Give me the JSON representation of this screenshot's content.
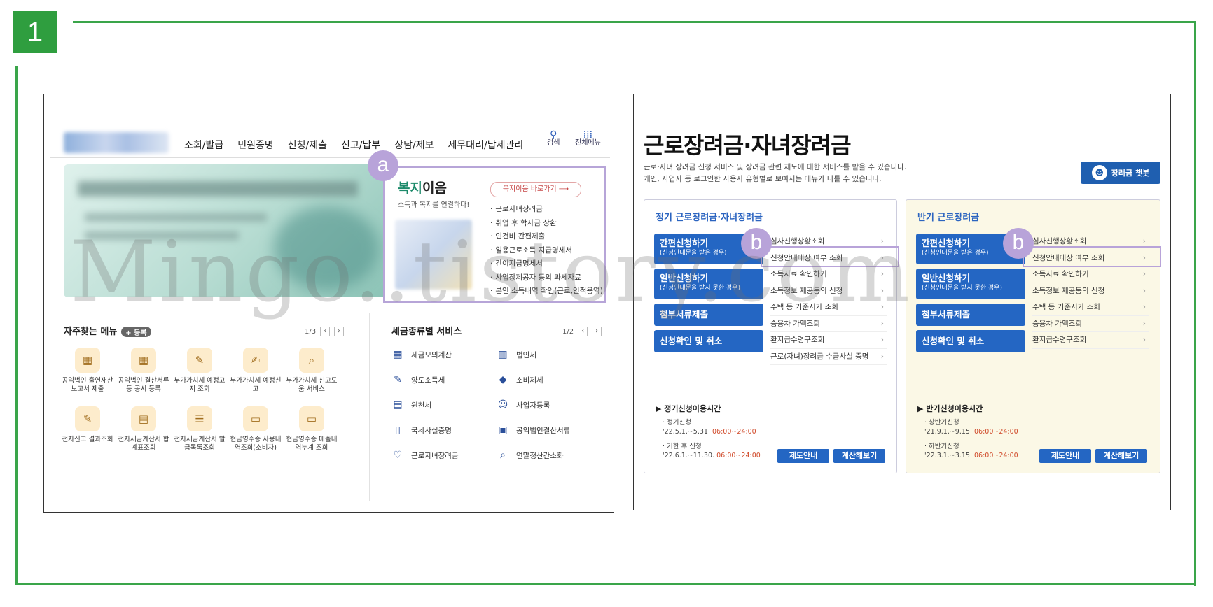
{
  "step_number": "1",
  "watermark": "Mingo..tistory.com",
  "left_screenshot": {
    "nav": {
      "items": [
        "조회/발급",
        "민원증명",
        "신청/제출",
        "신고/납부",
        "상담/제보",
        "세무대리/납세관리"
      ],
      "search_label": "검색",
      "all_menu_label": "전체메뉴",
      "search_icon": "search-icon",
      "all_menu_icon": "grid-icon"
    },
    "welfare": {
      "marker": "a",
      "title_accent": "복지",
      "title_rest": "이음",
      "subtitle": "소득과 복지를 연결하다!",
      "shortcut_button": "복지이음 바로가기 ⟶",
      "items": [
        "근로자녀장려금",
        "취업 후 학자금 상환",
        "인건비 간편제출",
        "일용근로소득 지급명세서",
        "간이지급명세서",
        "사업장제공자 등의 과세자료",
        "본인 소득내역 확인(근로,인적용역)"
      ]
    },
    "favorites": {
      "title": "자주찾는 메뉴",
      "register_label": "+ 등록",
      "pager": "1/3",
      "items": [
        {
          "label": "공익법인 출연재산 보고서 제출",
          "icon": "document-calendar-icon"
        },
        {
          "label": "공익법인 결산서류 등 공시 등록",
          "icon": "document-calendar-icon"
        },
        {
          "label": "부가가치세 예정고지 조회",
          "icon": "wd-document-icon"
        },
        {
          "label": "부가가치세 예정신고",
          "icon": "vat-document-icon"
        },
        {
          "label": "부가가치세 신고도움 서비스",
          "icon": "magnify-document-icon"
        },
        {
          "label": "전자신고 결과조회",
          "icon": "wd-document-icon"
        },
        {
          "label": "전자세금계산서 합계표조회",
          "icon": "calculator-document-icon"
        },
        {
          "label": "전자세금계산서 발급목록조회",
          "icon": "list-document-icon"
        },
        {
          "label": "현금영수증 사용내역조회(소비자)",
          "icon": "receipt-icon"
        },
        {
          "label": "현금영수증 매출내역누계 조회",
          "icon": "receipt-icon"
        }
      ]
    },
    "tax_services": {
      "title": "세금종류별 서비스",
      "pager": "1/2",
      "items": [
        {
          "label": "세금모의계산",
          "icon": "calculator-icon"
        },
        {
          "label": "법인세",
          "icon": "building-icon"
        },
        {
          "label": "양도소득세",
          "icon": "car-document-icon"
        },
        {
          "label": "소비제세",
          "icon": "diamond-icon"
        },
        {
          "label": "원천세",
          "icon": "stamp-document-icon"
        },
        {
          "label": "사업자등록",
          "icon": "person-icon"
        },
        {
          "label": "국세사실증명",
          "icon": "certificate-icon"
        },
        {
          "label": "공익법인결산서류",
          "icon": "clipboard-icon"
        },
        {
          "label": "근로자녀장려금",
          "icon": "heart-icon"
        },
        {
          "label": "연말정산간소화",
          "icon": "search-document-icon"
        }
      ]
    }
  },
  "right_screenshot": {
    "title": "근로장려금·자녀장려금",
    "description": [
      "근로·자녀 장려금 신청 서비스 및 장려금 관련 제도에 대한 서비스를 받을 수 있습니다.",
      "개인, 사업자 등 로그인한 사용자 유형별로 보여지는 메뉴가 다를 수 있습니다."
    ],
    "chatbot_label": "장려금 챗봇",
    "panels": [
      {
        "title": "정기 근로장려금·자녀장려금",
        "marker": "b",
        "buttons": [
          {
            "label": "간편신청하기",
            "sub": "(신청안내문을 받은 경우)"
          },
          {
            "label": "일반신청하기",
            "sub": "(신청안내문을 받지 못한 경우)"
          },
          {
            "label": "첨부서류제출",
            "sub": ""
          },
          {
            "label": "신청확인 및 취소",
            "sub": ""
          }
        ],
        "links": [
          "심사진행상황조회",
          "신청안내대상 여부 조회",
          "소득자료 확인하기",
          "소득정보 제공동의 신청",
          "주택 등 기준시가 조회",
          "승용차 가액조회",
          "환지급수령구조회",
          "근로(자녀)장려금 수급사실 증명"
        ],
        "time_heading": "▶ 정기신청이용시간",
        "schedule": [
          {
            "label": "· 정기신청",
            "dates": "'22.5.1.~5.31.",
            "hours": "06:00~24:00"
          },
          {
            "label": "· 기한 후 신청",
            "dates": "'22.6.1.~11.30.",
            "hours": "06:00~24:00"
          }
        ],
        "guide_button": "제도안내",
        "calc_button": "계산해보기"
      },
      {
        "title": "반기 근로장려금",
        "marker": "b",
        "buttons": [
          {
            "label": "간편신청하기",
            "sub": "(신청안내문을 받은 경우)"
          },
          {
            "label": "일반신청하기",
            "sub": "(신청안내문을 받지 못한 경우)"
          },
          {
            "label": "첨부서류제출",
            "sub": ""
          },
          {
            "label": "신청확인 및 취소",
            "sub": ""
          }
        ],
        "links": [
          "심사진행상황조회",
          "신청안내대상 여부 조회",
          "소득자료 확인하기",
          "소득정보 제공동의 신청",
          "주택 등 기준시가 조회",
          "승용차 가액조회",
          "환지급수령구조회"
        ],
        "time_heading": "▶ 반기신청이용시간",
        "schedule": [
          {
            "label": "· 상반기신청",
            "dates": "'21.9.1.~9.15.",
            "hours": "06:00~24:00"
          },
          {
            "label": "· 하반기신청",
            "dates": "'22.3.1.~3.15.",
            "hours": "06:00~24:00"
          }
        ],
        "guide_button": "제도안내",
        "calc_button": "계산해보기"
      }
    ]
  }
}
